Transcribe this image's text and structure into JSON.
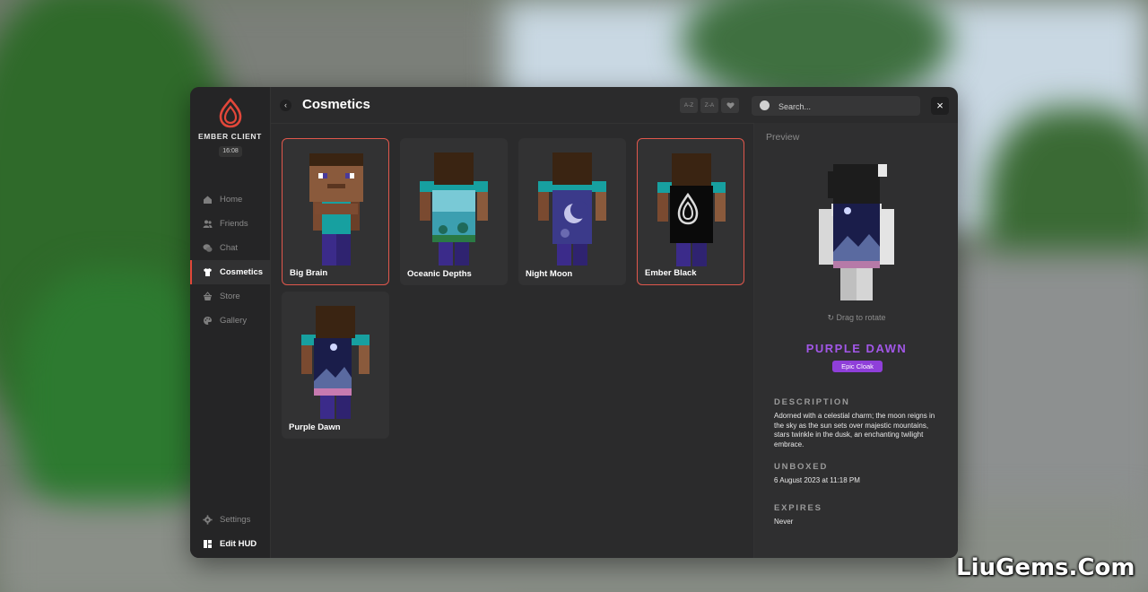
{
  "app": {
    "brand": "EMBER CLIENT",
    "clock": "16:08",
    "accent": "#e2473a"
  },
  "sidebar": {
    "items": [
      {
        "label": "Home",
        "icon": "home-icon"
      },
      {
        "label": "Friends",
        "icon": "friends-icon"
      },
      {
        "label": "Chat",
        "icon": "chat-icon"
      },
      {
        "label": "Cosmetics",
        "icon": "shirt-icon",
        "active": true
      },
      {
        "label": "Store",
        "icon": "basket-icon"
      },
      {
        "label": "Gallery",
        "icon": "palette-icon"
      }
    ],
    "bottom": [
      {
        "label": "Settings",
        "icon": "gear-icon"
      },
      {
        "label": "Edit HUD",
        "icon": "layout-icon"
      }
    ]
  },
  "header": {
    "title": "Cosmetics",
    "sort": [
      "A-Z",
      "Z-A"
    ],
    "search_placeholder": "Search..."
  },
  "cosmetics": [
    {
      "name": "Big Brain",
      "selected": true
    },
    {
      "name": "Oceanic Depths",
      "selected": false
    },
    {
      "name": "Night Moon",
      "selected": false
    },
    {
      "name": "Ember Black",
      "selected": true
    },
    {
      "name": "Purple Dawn",
      "selected": false
    }
  ],
  "preview": {
    "heading": "Preview",
    "drag_hint": "Drag to rotate",
    "name": "PURPLE DAWN",
    "rarity": "Epic Cloak",
    "rarity_color": "#8f3fd9",
    "description_label": "DESCRIPTION",
    "description": "Adorned with a celestial charm; the moon reigns in the sky as the sun sets over majestic mountains, stars twinkle in the dusk, an enchanting twilight embrace.",
    "unboxed_label": "UNBOXED",
    "unboxed": "6 August 2023 at 11:18 PM",
    "expires_label": "EXPIRES",
    "expires": "Never"
  },
  "watermark": "LiuGems.Com"
}
